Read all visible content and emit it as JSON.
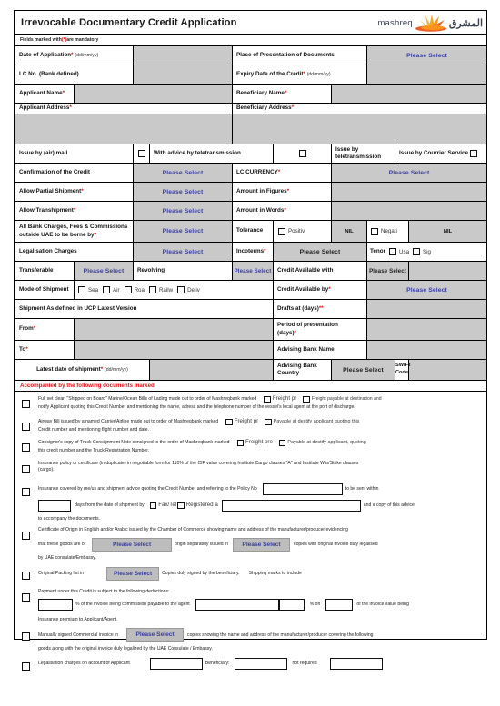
{
  "header": {
    "title": "Irrevocable Documentary Credit Application",
    "logo_en": "mashreq",
    "logo_ar": "المشرق",
    "mandatory_note_pre": "Fields marked with ",
    "mandatory_note_star": "(*)",
    "mandatory_note_post": " are mandatory"
  },
  "common": {
    "please_select": "Please Select",
    "nil": "NIL",
    "date_fmt": "(dd/mm/yy)"
  },
  "grid": {
    "date_of_application": "Date of Application",
    "place_of_presentation": "Place of Presentation of Documents",
    "lc_no": "LC No. (Bank defined)",
    "expiry_date": "Expiry Date of the Credit",
    "applicant_name": "Applicant Name",
    "beneficiary_name": "Beneficiary Name",
    "applicant_address": "Applicant Address",
    "beneficiary_address": "Beneficiary Address",
    "issue_air_mail": "Issue by (air) mail",
    "with_advice_tele": "With advice by teletransmission",
    "issue_tele": "Issue by teletransmission",
    "issue_courier": "Issue by Courrier Service",
    "confirmation": "Confirmation of the Credit",
    "lc_currency": "LC CURRENCY",
    "allow_partial": "Allow Partial Shipment",
    "amount_figures": "Amount in Figures",
    "allow_transhipment": "Allow Transhipment",
    "amount_words": "Amount in Words",
    "bank_charges_l1": "All Bank Charges, Fees & Commissions",
    "bank_charges_l2": "outside UAE to be borne by",
    "tolerance": "Tolerance",
    "tol_positive": "Positiv",
    "tol_negative": "Negati",
    "legalisation_charges": "Legalisation Charges",
    "incoterms": "Incoterms",
    "tenor": "Tenor",
    "tenor_usance": "Usa",
    "tenor_sight": "Sig",
    "transferable": "Transferable",
    "revolving": "Revolving",
    "credit_available_with": "Credit Available with",
    "mode_of_shipment": "Mode of Shipment",
    "mode_sea": "Sea",
    "mode_air": "Air",
    "mode_road": "Roa",
    "mode_rail": "Railw",
    "mode_delivery": "Deliv",
    "credit_available_by": "Credit Available by",
    "shipment_ucp": "Shipment As defined in UCP Latest Version",
    "drafts_at": "Drafts at (days)",
    "drafts_at_req": "**",
    "from": "From",
    "period_presentation_l1": "Period of presentation",
    "period_presentation_l2": "(days)",
    "to": "To",
    "advising_bank_name": "Advising Bank Name",
    "latest_date_shipment": "Latest date of shipment",
    "advising_bank_country": "Advising Bank Country",
    "swift_l1": "SWIFT",
    "swift_l2": "Code"
  },
  "docs": {
    "band": "Accompanied by the following documents marked",
    "items": [
      {
        "id": "bill-of-lading",
        "text_a": "Full set clean \"Shipped on Board\" Marine/Ocean Bills of Lading made out to order of Mashreqbank marked",
        "chk1": "Freight pr",
        "chk2": "Freight payable at destination and",
        "text_b": "notify Applicant quoting this Credit Number and mentioning the name, adress and the telephone number of the vessel's local agent at the port of discharge."
      },
      {
        "id": "airway-bill",
        "text_a": "Airway Bill issued by a named Carrier/Airline made out to order of Mashreqbank marked",
        "chk1": "Freight pr",
        "chk2": "Payable at destify applicant quoting this",
        "text_b": "Credit number and mentioning flight number and date."
      },
      {
        "id": "truck-consignment-note",
        "text_a": "Consignor's copy of Truck Consignment Note consigned to the order of Mashreqbank marked",
        "chk1": "Freight pre",
        "chk2": "Payable at destify applicant, quoting",
        "text_b": "this credit number and the Truck Registration Number."
      },
      {
        "id": "insurance-policy",
        "text_a": "Insurance policy or certificate (in duplicate) in negotiable form for 110% of the CIF value covering Institute Cargo clauses \"A\" and Institute War/Strike clauses",
        "text_b": "(cargo)."
      }
    ],
    "insurance_covered": {
      "lead": "Insurance covered by me/us and shipment advice quoting the Credit Number and referring to the Policy No",
      "tail": "to be sent within",
      "days_label": "days from the date of shipment by",
      "fax_tel": "Fax/Tel",
      "registered": "Registered a",
      "copy_tail": "and a copy of this advice",
      "accompany": "to accompany the documents."
    },
    "certificate_origin": {
      "line1": "Certificate of Origin in English and/or Arabic issued by the Chamber of Commerce showing name and address of the manufacturer/producer evidencing",
      "line2_a": "that these goods are of",
      "line2_b": "origin separately issued in",
      "line2_c": "copies with original invoice duly legalised",
      "line3": "by UAE consulate/Embassy."
    },
    "packing_list": {
      "lead": "Original Packing list in",
      "mid": "Copies duly signed by the beneficiary.",
      "tail": "Shipping marks to include"
    },
    "payment_deductions": {
      "lead": "Payment under this Credit is subject to the following deductions:",
      "a": "% of the invoice being commission payable to the agent",
      "b": "% on",
      "c": "of the invoice value being",
      "d": "Insurance premium to Applicant/Agent."
    },
    "commercial_invoice": {
      "lead": "Manually signed Commercial invoice in",
      "mid": "copies showing the name and address of the manufacturer/producer covering the following",
      "line2": "goods along with the original invoice duly legalized by the UAE Consulate / Embassy."
    },
    "legalisation": {
      "lead": "Legalisation charges on account of Applicant",
      "beneficiary": "Beneficiary:",
      "not_required": "not required"
    }
  }
}
